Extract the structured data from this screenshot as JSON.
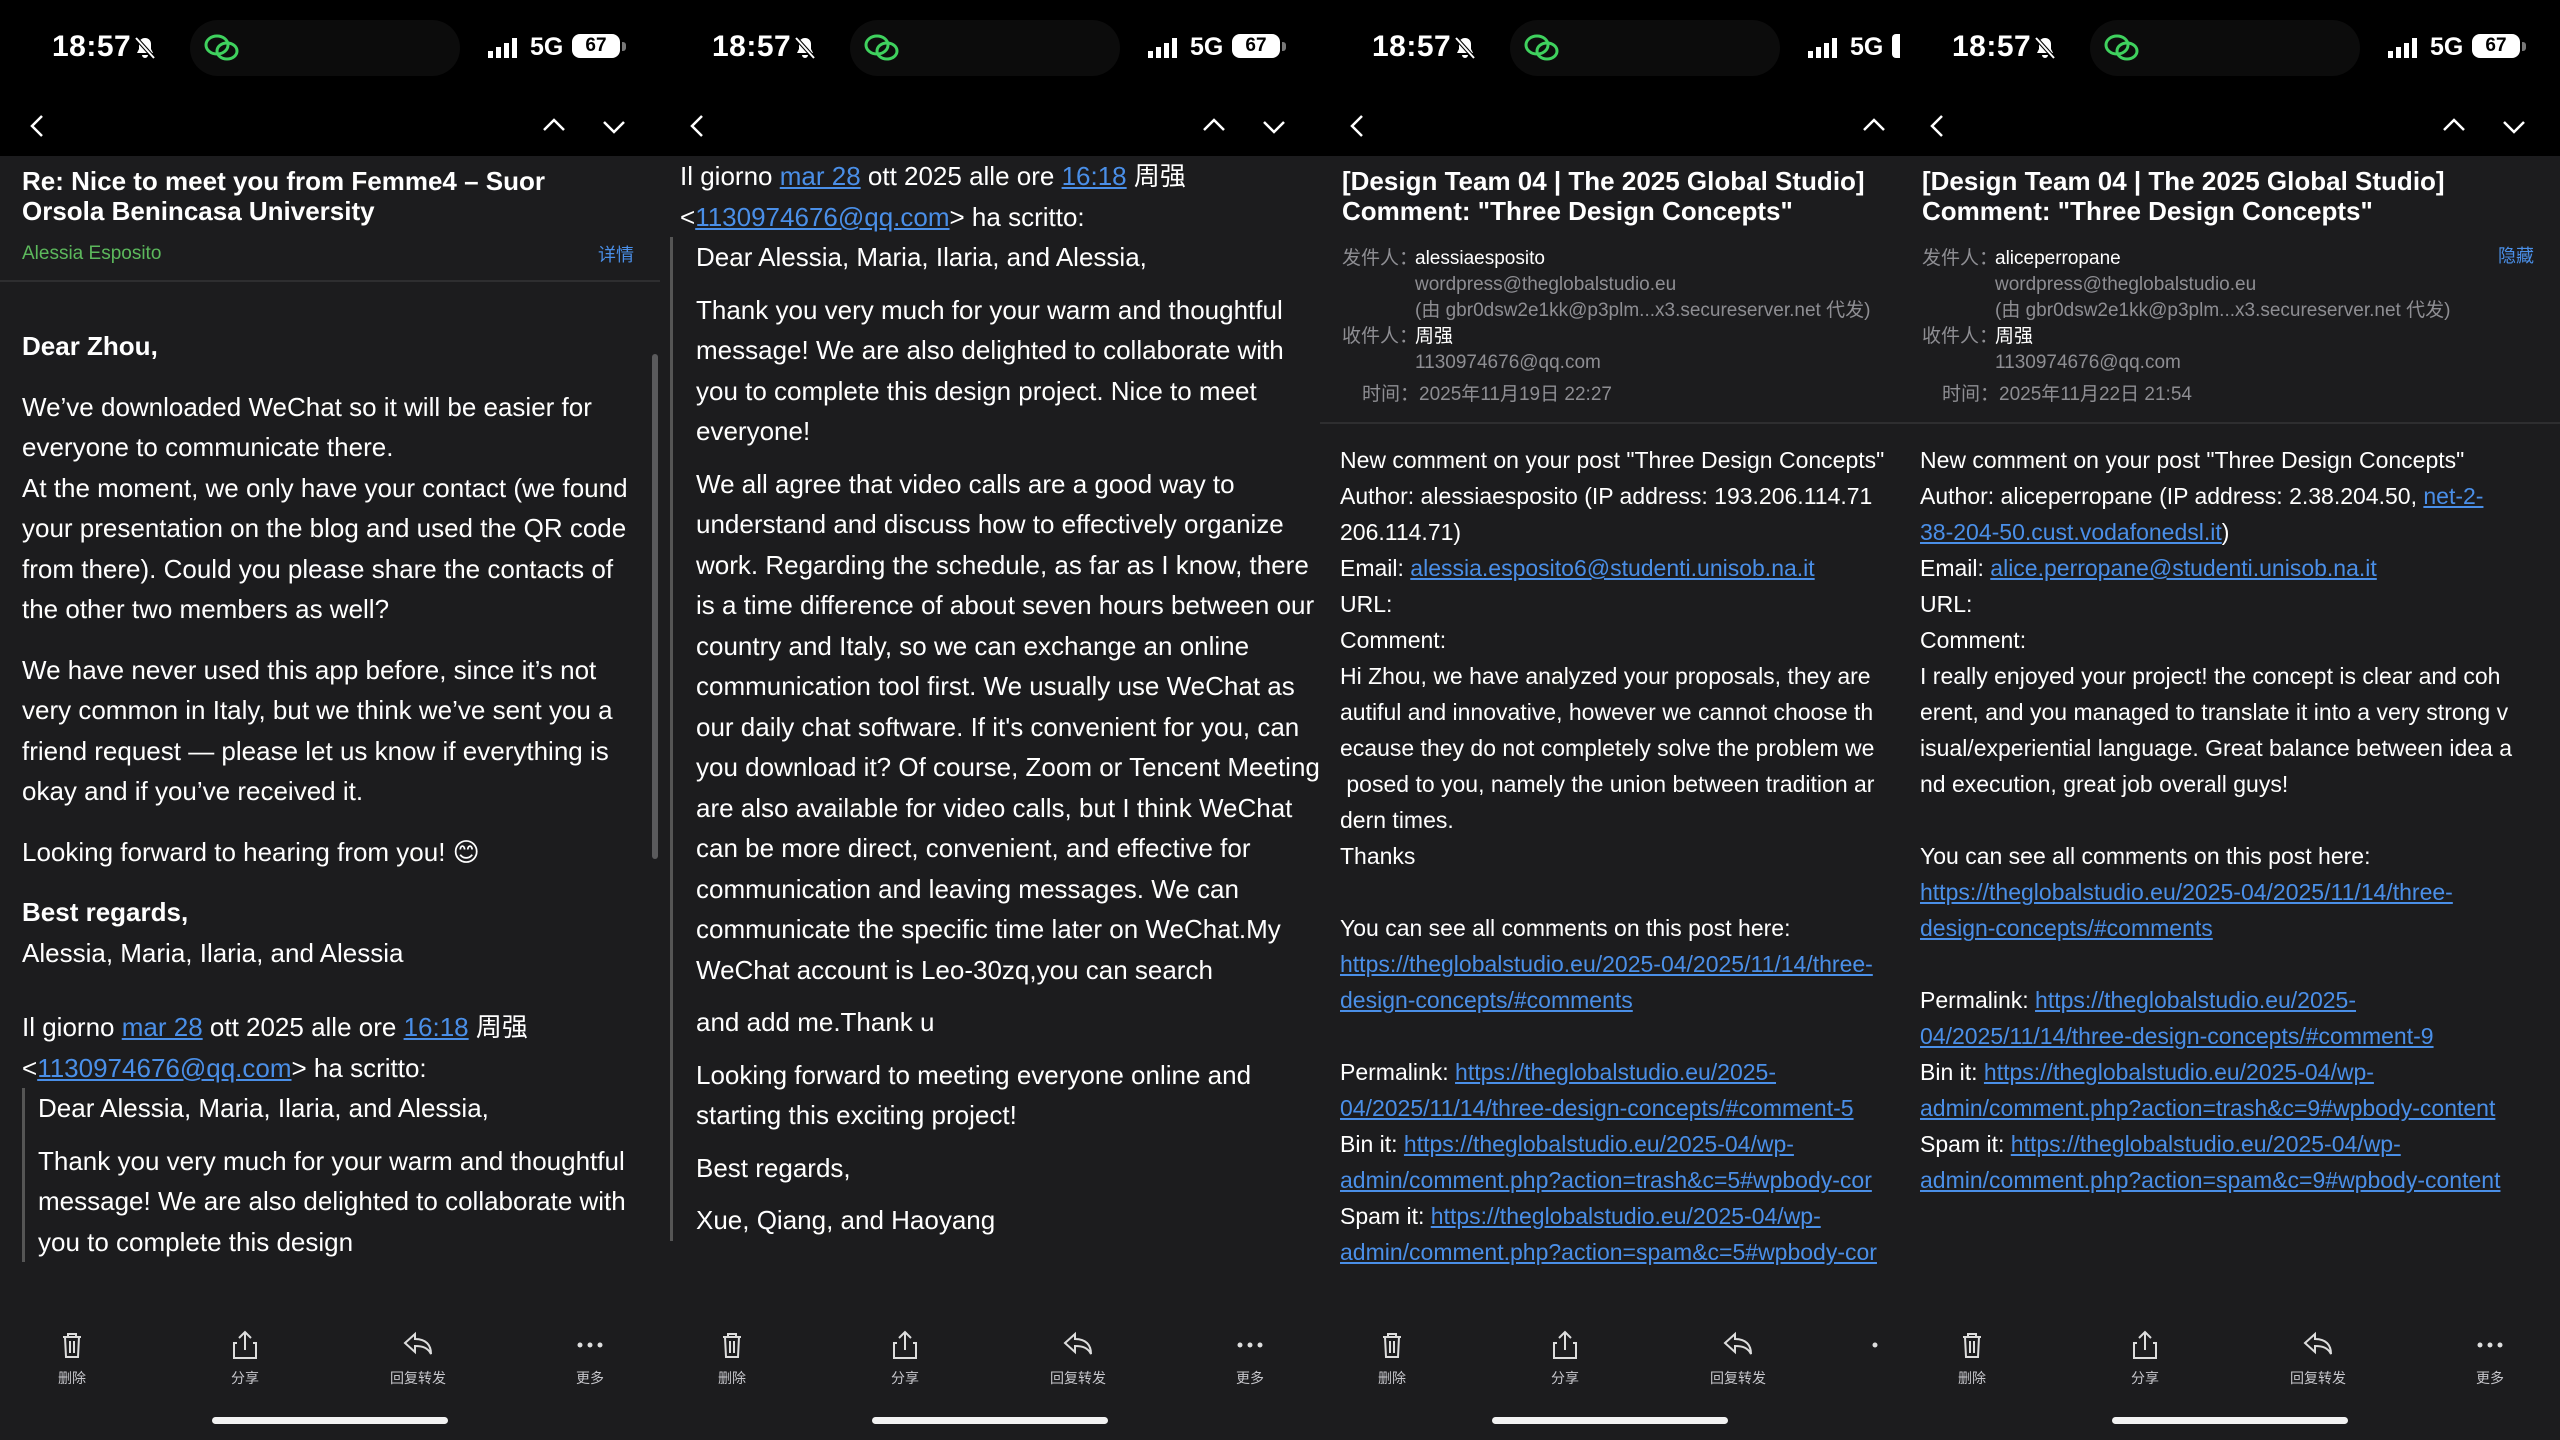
{
  "status": {
    "time": "18:57",
    "network": "5G",
    "battery": "67"
  },
  "toolbar": {
    "delete": "删除",
    "share": "分享",
    "reply_forward": "回复转发",
    "more": "更多"
  },
  "panel1": {
    "subject": "Re: Nice to meet you from Femme4 – Suor Orsola Benincasa University",
    "sender": "Alessia Esposito",
    "details": "详情",
    "greeting": "Dear  Zhou,",
    "para1": "We’ve downloaded WeChat so it will be easier for everyone to communicate there.",
    "para1b": "At the moment, we only have your contact (we found your presentation on the blog and used the QR code from there). Could you please share the contacts of the other two members as well?",
    "para2": "We have never used this app before, since it’s not very common in Italy, but we think we’ve sent you a friend request — please let us know if everything is okay and if you’ve received it.",
    "para3": "Looking forward to hearing from you! 😊",
    "closing": "Best regards,",
    "signature": "Alessia, Maria, Ilaria, and Alessia",
    "quote_head_1": "Il giorno ",
    "quote_date": "mar 28",
    "quote_head_2": " ott 2025 alle ore ",
    "quote_time": "16:18",
    "quote_head_3": " 周强",
    "quote_lt": "<",
    "quote_email": "1130974676@qq.com",
    "quote_head_4": "> ha scritto:",
    "q_greeting": "Dear Alessia, Maria, Ilaria, and Alessia,",
    "q_para1": "Thank you very much for your warm and thoughtful message! We are also delighted to collaborate with you to complete this design"
  },
  "panel2": {
    "quote_head_1": "Il giorno ",
    "quote_date": "mar 28",
    "quote_head_2": " ott 2025 alle ore ",
    "quote_time": "16:18",
    "quote_head_3": " 周强",
    "quote_lt": "<",
    "quote_email": "1130974676@qq.com",
    "quote_head_4": "> ha scritto:",
    "greeting": "Dear Alessia, Maria, Ilaria, and Alessia,",
    "para1": "Thank you very much for your warm and thoughtful message! We are also delighted to collaborate with you to complete this design project. Nice to meet everyone!",
    "para2": "We all agree that video calls are a good way to understand and discuss how to effectively organize work. Regarding the schedule, as far as I know, there is a time difference of about seven hours between our country and Italy, so we can exchange an online communication tool first. We usually use WeChat as our daily chat software. If it's convenient for you, can you download it? Of course, Zoom or Tencent Meeting are also available for video calls, but I think WeChat can be more direct, convenient, and effective for communication and leaving messages. We can communicate the specific time later on WeChat.My WeChat account is Leo-30zq,you can search",
    "para3": "and add me.Thank u",
    "para4": "Looking forward to meeting everyone online and starting this exciting project!",
    "closing": "Best regards,",
    "signature": "Xue, Qiang, and Haoyang"
  },
  "panel3": {
    "subject": "[Design Team 04 | The 2025 Global Studio] Comment: \"Three Design Concepts\"",
    "from_label": "发件人：",
    "from_name": "alessiaesposito",
    "from_addr": "wordpress@theglobalstudio.eu",
    "from_via": "(由 gbr0dsw2e1kk@p3plm...x3.secureserver.net 代发)",
    "to_label": "收件人：",
    "to_name": "周强",
    "to_addr": "1130974676@qq.com",
    "time": "时间：2025年11月19日 22:27",
    "l1": "New comment on your post \"Three Design Concepts\"",
    "l2": "Author: alessiaesposito (IP address: 193.206.114.71",
    "l3": "206.114.71)",
    "l4_label": "Email: ",
    "l4_link": "alessia.esposito6@studenti.unisob.na.it",
    "l5": "URL:",
    "l6": "Comment:",
    "c1": "Hi Zhou, we have analyzed your proposals, they are",
    "c2": "autiful and innovative, however we cannot choose th",
    "c3": "ecause they do not completely solve the problem we",
    "c4": " posed to you, namely the union between tradition ar",
    "c5": "dern times.",
    "c6": "Thanks",
    "all": "You can see all comments on this post here:",
    "all_link1": "https://theglobalstudio.eu/2025-04/2025/11/14/three-",
    "all_link2": "design-concepts/#comments",
    "perma_label": "Permalink: ",
    "perma_link1": "https://theglobalstudio.eu/2025-",
    "perma_link2": "04/2025/11/14/three-design-concepts/#comment-5",
    "bin_label": "Bin it: ",
    "bin_link1": "https://theglobalstudio.eu/2025-04/wp-",
    "bin_link2": "admin/comment.php?action=trash&c=5#wpbody-cor",
    "spam_label": "Spam it: ",
    "spam_link1": "https://theglobalstudio.eu/2025-04/wp-",
    "spam_link2": "admin/comment.php?action=spam&c=5#wpbody-cor"
  },
  "panel4": {
    "subject": "[Design Team 04 | The 2025 Global Studio] Comment: \"Three Design Concepts\"",
    "hide": "隐藏",
    "from_label": "发件人：",
    "from_name": "aliceperropane",
    "from_addr": "wordpress@theglobalstudio.eu",
    "from_via": "(由 gbr0dsw2e1kk@p3plm...x3.secureserver.net 代发)",
    "to_label": "收件人：",
    "to_name": "周强",
    "to_addr": "1130974676@qq.com",
    "time": "时间：2025年11月22日 21:54",
    "l1": "New comment on your post \"Three Design Concepts\"",
    "l2": "Author: aliceperropane (IP address: 2.38.204.50, ",
    "l2_link": "net-2-",
    "l3_link": "38-204-50.cust.vodafonedsl.it",
    "l3_tail": ")",
    "l4_label": "Email: ",
    "l4_link": "alice.perropane@studenti.unisob.na.it",
    "l5": "URL:",
    "l6": "Comment:",
    "c1": "I really enjoyed your project! the concept is clear and coh",
    "c2": "erent, and you managed to translate it into a very strong v",
    "c3": "isual/experiential language. Great balance between idea a",
    "c4": "nd execution, great job overall guys!",
    "all": "You can see all comments on this post here:",
    "all_link1": "https://theglobalstudio.eu/2025-04/2025/11/14/three-",
    "all_link2": "design-concepts/#comments",
    "perma_label": "Permalink: ",
    "perma_link1": "https://theglobalstudio.eu/2025-",
    "perma_link2": "04/2025/11/14/three-design-concepts/#comment-9",
    "bin_label": "Bin it: ",
    "bin_link1": "https://theglobalstudio.eu/2025-04/wp-",
    "bin_link2": "admin/comment.php?action=trash&c=9#wpbody-content",
    "spam_label": "Spam it: ",
    "spam_link1": "https://theglobalstudio.eu/2025-04/wp-",
    "spam_link2": "admin/comment.php?action=spam&c=9#wpbody-content"
  }
}
